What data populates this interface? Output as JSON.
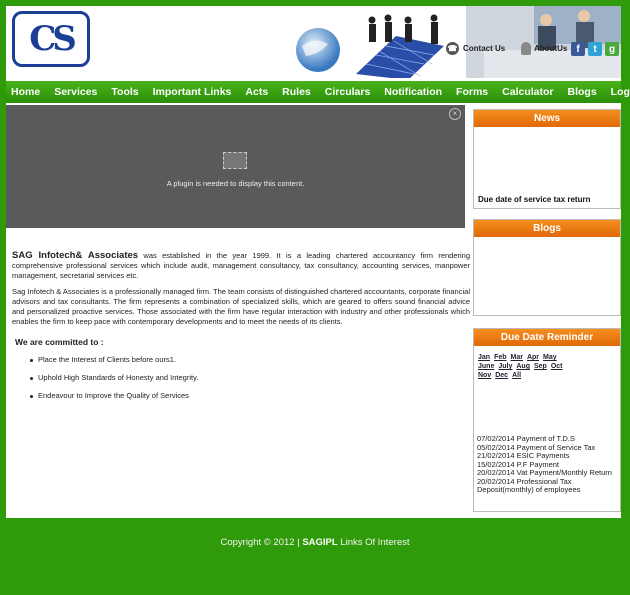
{
  "header": {
    "logo_text": "CS",
    "contact_label": "Contact Us",
    "about_label": "AboutUs",
    "social": [
      "facebook-icon",
      "twitter-icon",
      "google-icon"
    ]
  },
  "nav": {
    "items": [
      "Home",
      "Services",
      "Tools",
      "Important Links",
      "Acts",
      "Rules",
      "Circulars",
      "Notification",
      "Forms",
      "Calculator",
      "Blogs",
      "Login"
    ]
  },
  "plugin": {
    "message": "A plugin is needed to display this content."
  },
  "content": {
    "firm_name": "SAG Infotech& Associates",
    "intro_rest": " was established in the year 1999. It is a leading chartered accountancy firm rendering comprehensive professional services which include audit, management consultancy, tax consultancy, accounting services, manpower management, secretarial services etc.",
    "para2": "Sag Infotech & Associates is a professionally managed firm. The team consists of distinguished chartered accountants, corporate financial advisors and tax consultants. The firm represents a combination of specialized skills, which are geared to offers sound financial advice and personalized proactive services. Those associated with the firm have regular interaction with industry and other professionals which enables the firm to keep pace with contemporary developments and to meet the needs of its clients.",
    "commit_heading": "We are committed to :",
    "commitments": [
      "Place the Interest of Clients before ours1.",
      "Uphold High Standards of Honesty and Integrity.",
      "Endeavour to Improve the Quality of Services"
    ]
  },
  "sidebar": {
    "news_title": "News",
    "news_item": "Due date of service tax return",
    "blogs_title": "Blogs",
    "due_title": "Due Date Reminder",
    "months": [
      "Jan",
      "Feb",
      "Mar",
      "Apr",
      "May",
      "June",
      "July",
      "Aug",
      "Sep",
      "Oct",
      "Nov",
      "Dec",
      "All"
    ],
    "dues": [
      "07/02/2014 Payment of T.D.S",
      "05/02/2014 Payment of Service Tax",
      "21/02/2014 ESIC Payments",
      "15/02/2014 P.F Payment",
      "20/02/2014 Vat Payment/Monthly Return",
      "20/02/2014 Professional Tax Deposit(monthly) of employees"
    ]
  },
  "footer": {
    "prefix": "Copyright © 2012 | ",
    "company": "SAGIPL",
    "suffix": " Links Of Interest"
  },
  "colors": {
    "background_green": "#2f9a0a",
    "nav_green": "#3aa312",
    "panel_orange": "#ee7a12",
    "logo_blue": "#1a3f95"
  }
}
